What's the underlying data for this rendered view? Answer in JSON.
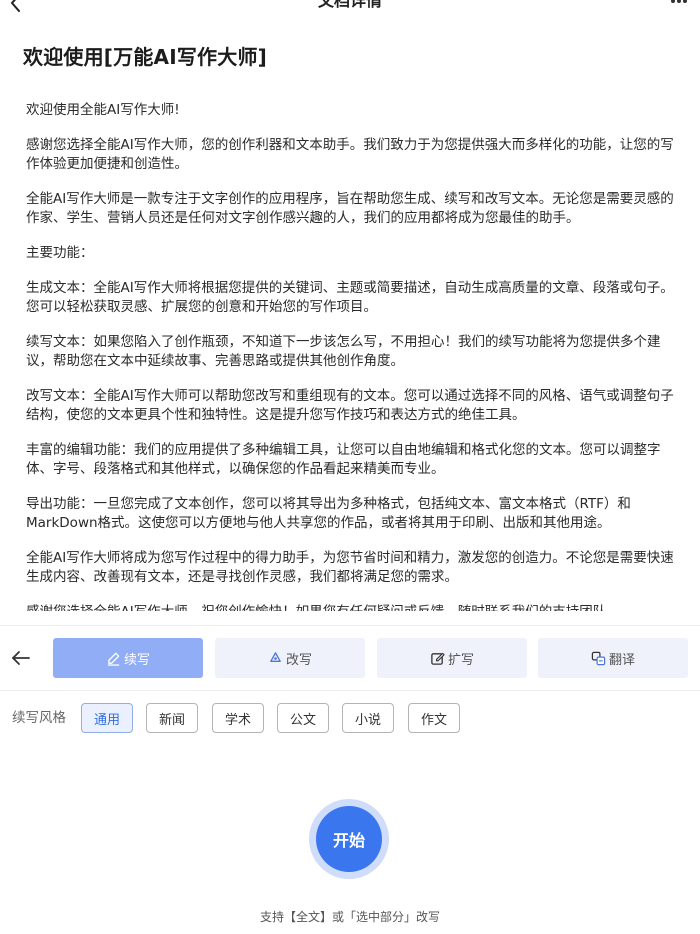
{
  "nav": {
    "title": "文档详情"
  },
  "document": {
    "title": "欢迎使用[万能AI写作大师]",
    "paragraphs": [
      "欢迎使用全能AI写作大师!",
      "感谢您选择全能AI写作大师，您的创作利器和文本助手。我们致力于为您提供强大而多样化的功能，让您的写作体验更加便捷和创造性。",
      "全能AI写作大师是一款专注于文字创作的应用程序，旨在帮助您生成、续写和改写文本。无论您是需要灵感的作家、学生、营销人员还是任何对文字创作感兴趣的人，我们的应用都将成为您最佳的助手。",
      "主要功能：",
      "生成文本：全能AI写作大师将根据您提供的关键词、主题或简要描述，自动生成高质量的文章、段落或句子。您可以轻松获取灵感、扩展您的创意和开始您的写作项目。",
      "续写文本：如果您陷入了创作瓶颈，不知道下一步该怎么写，不用担心！我们的续写功能将为您提供多个建议，帮助您在文本中延续故事、完善思路或提供其他创作角度。",
      "改写文本：全能AI写作大师可以帮助您改写和重组现有的文本。您可以通过选择不同的风格、语气或调整句子结构，使您的文本更具个性和独特性。这是提升您写作技巧和表达方式的绝佳工具。",
      "丰富的编辑功能：我们的应用提供了多种编辑工具，让您可以自由地编辑和格式化您的文本。您可以调整字体、字号、段落格式和其他样式，以确保您的作品看起来精美而专业。",
      "导出功能：一旦您完成了文本创作，您可以将其导出为多种格式，包括纯文本、富文本格式（RTF）和MarkDown格式。这使您可以方便地与他人共享您的作品，或者将其用于印刷、出版和其他用途。",
      "全能AI写作大师将成为您写作过程中的得力助手，为您节省时间和精力，激发您的创造力。不论您是需要快速生成内容、改善现有文本，还是寻找创作灵感，我们都将满足您的需求。",
      "感谢您选择全能AI写作大师，祝您创作愉快！如果您有任何疑问或反馈，随时联系我们的支持团队。"
    ]
  },
  "panel": {
    "tabs": [
      {
        "label": "续写",
        "icon": "pen-icon",
        "active": true
      },
      {
        "label": "改写",
        "icon": "recycle-icon",
        "active": false
      },
      {
        "label": "扩写",
        "icon": "edit-square-icon",
        "active": false
      },
      {
        "label": "翻译",
        "icon": "translate-icon",
        "active": false
      }
    ],
    "style_label": "续写风格",
    "styles": [
      {
        "label": "通用",
        "active": true
      },
      {
        "label": "新闻",
        "active": false
      },
      {
        "label": "学术",
        "active": false
      },
      {
        "label": "公文",
        "active": false
      },
      {
        "label": "小说",
        "active": false
      },
      {
        "label": "作文",
        "active": false
      }
    ],
    "start_label": "开始",
    "hint": "支持【全文】或「选中部分」改写"
  },
  "colors": {
    "accent": "#3a76ee",
    "tab_active": "#90adf6",
    "tab_inactive": "#eff2fa"
  }
}
